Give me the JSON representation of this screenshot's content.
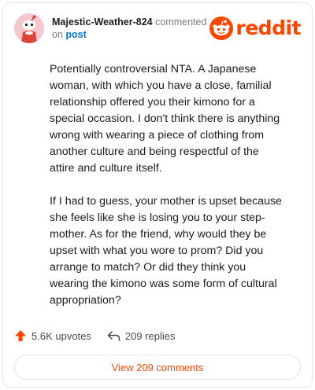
{
  "comment": {
    "username": "Majestic-Weather-824",
    "action_text": "commented",
    "on_text": "on",
    "post_link": "post",
    "paragraphs": [
      "Potentially controversial NTA. A Japanese woman, with which you have a close, familial relationship offered you their kimono for a special occasion. I don't think there is anything wrong with wearing a piece of clothing from another culture and being respectful of the attire and culture itself.",
      "If I had to guess, your mother is upset because she feels like she is losing you to your step-mother. As for the friend, why would they be upset with what you wore to prom? Did you arrange to match? Or did they think you wearing the kimono was some form of cultural appropriation?"
    ],
    "upvotes": "5.6K upvotes",
    "replies": "209 replies",
    "view_comments": "View 209 comments"
  },
  "brand": {
    "name": "reddit",
    "icon": "reddit-snoo-icon",
    "color": "#ff4500"
  },
  "icons": {
    "upvote": "upvote-arrow-icon",
    "reply": "reply-arrow-icon"
  },
  "colors": {
    "accent": "#ff4500",
    "link": "#0079d3",
    "avatar_bg": "#f6c7cd"
  }
}
